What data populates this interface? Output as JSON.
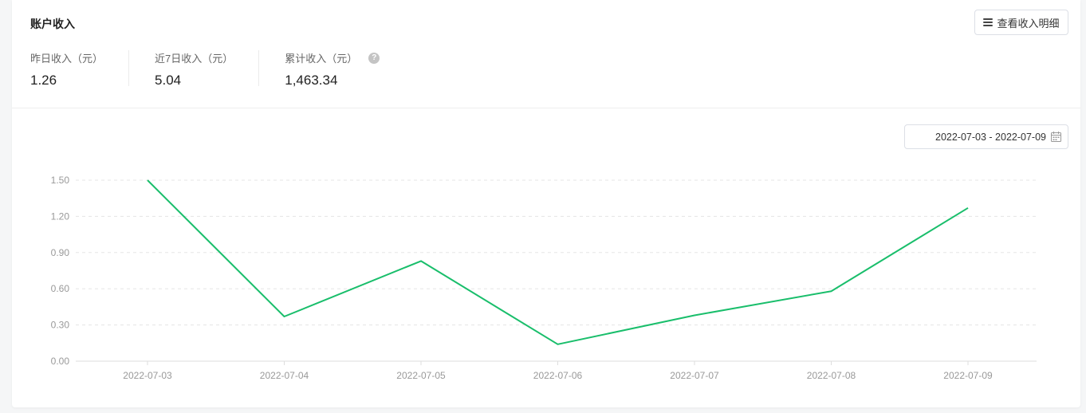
{
  "header": {
    "title": "账户收入",
    "detail_button_label": "查看收入明细"
  },
  "stats": [
    {
      "label": "昨日收入（元）",
      "value": "1.26"
    },
    {
      "label": "近7日收入（元）",
      "value": "5.04"
    },
    {
      "label": "累计收入（元）",
      "value": "1,463.34",
      "has_help": true
    }
  ],
  "help_icon_glyph": "?",
  "date_range": {
    "value": "2022-07-03 - 2022-07-09",
    "icon": "calendar-icon"
  },
  "colors": {
    "line": "#19be6b",
    "grid": "#e5e5e5",
    "axis_text": "#999999"
  },
  "chart_data": {
    "type": "line",
    "title": "",
    "xlabel": "",
    "ylabel": "",
    "categories": [
      "2022-07-03",
      "2022-07-04",
      "2022-07-05",
      "2022-07-06",
      "2022-07-07",
      "2022-07-08",
      "2022-07-09"
    ],
    "values": [
      1.5,
      0.37,
      0.83,
      0.14,
      0.38,
      0.58,
      1.27
    ],
    "yticks": [
      "0.00",
      "0.30",
      "0.60",
      "0.90",
      "1.20",
      "1.50"
    ],
    "ylim": [
      0,
      1.5
    ],
    "grid": true,
    "grid_style": "dashed"
  }
}
